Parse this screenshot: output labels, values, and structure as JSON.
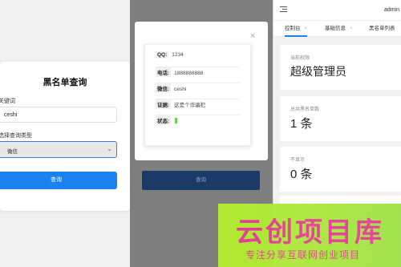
{
  "search_form": {
    "title": "黑名单查询",
    "keyword_label": "关键词",
    "keyword_value": "ceshi",
    "type_label": "选择查询类型",
    "type_value": "微信",
    "submit_label": "查询"
  },
  "result_dialog": {
    "close_glyph": "×",
    "rows": [
      {
        "key": "QQ:",
        "value": "1234"
      },
      {
        "key": "电话:",
        "value": "1888888888"
      },
      {
        "key": "微信:",
        "value": "ceshi"
      },
      {
        "key": "证据:",
        "value": "这是个诈骗犯"
      },
      {
        "key": "状态:",
        "value": "",
        "status_color": "#6fcf4a"
      }
    ],
    "submit_label": "查询"
  },
  "admin": {
    "user": "admin",
    "tabs": [
      {
        "label": "控制台",
        "active": true
      },
      {
        "label": "基础信息",
        "active": false
      },
      {
        "label": "黑名单列表",
        "active": false
      }
    ],
    "tab_close_glyph": "×",
    "cards": [
      {
        "label": "当前权限",
        "value": "超级管理员"
      },
      {
        "label": "总共黑名单数",
        "value": "1 条"
      },
      {
        "label": "不显示",
        "value": "0 条"
      }
    ]
  },
  "watermark": {
    "main_text": "云创项目库",
    "sub_text": "专注分享互联网创业项目"
  },
  "colors": {
    "primary": "#1a82f0",
    "dialog_button": "#1a3a67",
    "watermark_bg": "#b6ef2e",
    "watermark_text": "#e63f95"
  }
}
